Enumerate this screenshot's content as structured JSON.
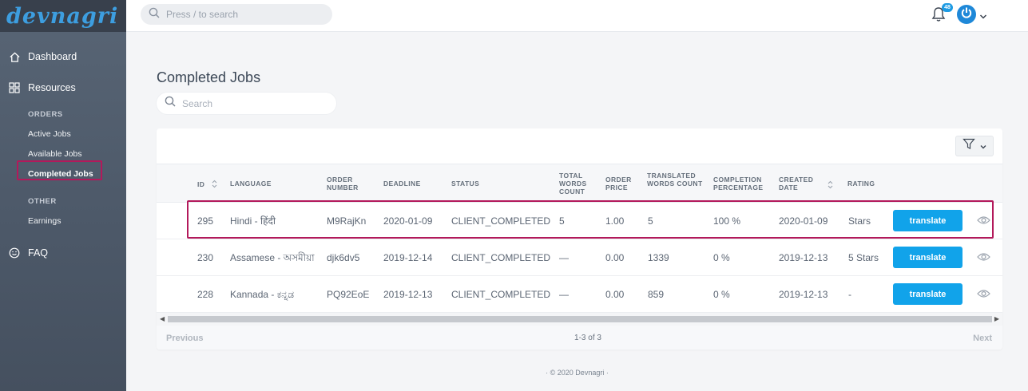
{
  "brand": {
    "logo_text": "devnagri"
  },
  "topbar": {
    "search_placeholder": "Press / to search",
    "notification_count": "48",
    "bell_icon": "bell-icon",
    "avatar_icon": "power-icon"
  },
  "sidebar": {
    "dashboard": "Dashboard",
    "resources": "Resources",
    "orders_heading": "ORDERS",
    "active_jobs": "Active Jobs",
    "available_jobs": "Available Jobs",
    "completed_jobs": "Completed Jobs",
    "other_heading": "OTHER",
    "earnings": "Earnings",
    "faq": "FAQ"
  },
  "main": {
    "title": "Completed Jobs",
    "search_placeholder": "Search"
  },
  "table": {
    "headers": {
      "id": "ID",
      "language": "LANGUAGE",
      "order_number": "ORDER NUMBER",
      "deadline": "DEADLINE",
      "status": "STATUS",
      "total_words": "TOTAL WORDS COUNT",
      "order_price": "ORDER PRICE",
      "translated_words": "TRANSLATED WORDS COUNT",
      "completion": "COMPLETION PERCENTAGE",
      "created": "CREATED DATE",
      "rating": "RATING"
    },
    "rows": [
      {
        "id": "295",
        "language": "Hindi - हिंदी",
        "order_number": "M9RajKn",
        "deadline": "2020-01-09",
        "status": "CLIENT_COMPLETED",
        "total_words": "5",
        "order_price": "1.00",
        "translated_words": "5",
        "completion": "100 %",
        "created": "2020-01-09",
        "rating": "Stars",
        "action": "translate"
      },
      {
        "id": "230",
        "language": "Assamese - অসমীয়া",
        "order_number": "djk6dv5",
        "deadline": "2019-12-14",
        "status": "CLIENT_COMPLETED",
        "total_words": "—",
        "order_price": "0.00",
        "translated_words": "1339",
        "completion": "0 %",
        "created": "2019-12-13",
        "rating": "5 Stars",
        "action": "translate"
      },
      {
        "id": "228",
        "language": "Kannada - ಕನ್ನಡ",
        "order_number": "PQ92EoE",
        "deadline": "2019-12-13",
        "status": "CLIENT_COMPLETED",
        "total_words": "—",
        "order_price": "0.00",
        "translated_words": "859",
        "completion": "0 %",
        "created": "2019-12-13",
        "rating": "-",
        "action": "translate"
      }
    ]
  },
  "pagination": {
    "previous": "Previous",
    "info": "1-3 of 3",
    "next": "Next"
  },
  "footer": {
    "text": "· © 2020 Devnagri ·"
  },
  "colors": {
    "accent": "#11a3ea",
    "highlight": "#b3195b",
    "sidebar": "#505c6b"
  }
}
